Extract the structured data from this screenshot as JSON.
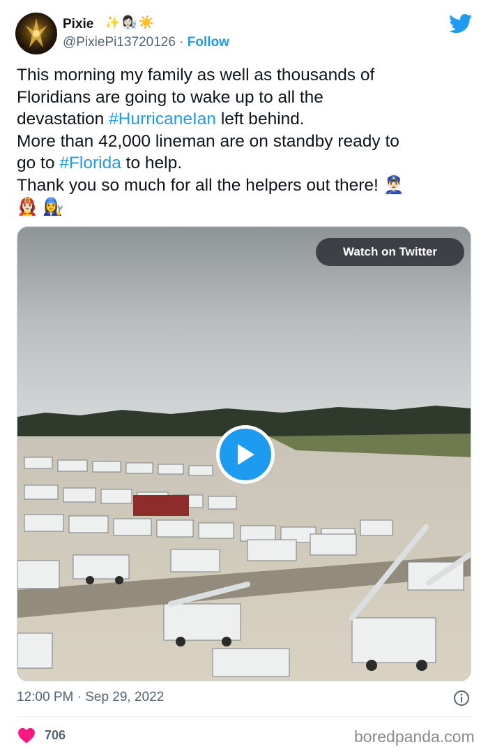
{
  "author": {
    "display_name": "Pixie",
    "name_emoji": "✨👩🏻‍🔬☀️",
    "handle": "@PixiePi13720126",
    "separator": " · ",
    "follow_label": "Follow"
  },
  "tweet": {
    "lines": [
      [
        {
          "text": "This morning my family as well as thousands of"
        }
      ],
      [
        {
          "text": "Floridians are going to wake up to all the"
        }
      ],
      [
        {
          "text": "devastation "
        },
        {
          "text": "#HurricaneIan",
          "hashtag": true
        },
        {
          "text": " left behind."
        }
      ],
      [
        {
          "text": "More than 42,000 lineman are on standby ready to"
        }
      ],
      [
        {
          "text": "go to "
        },
        {
          "text": "#Florida",
          "hashtag": true
        },
        {
          "text": " to help."
        }
      ],
      [
        {
          "text": "Thank you so much for all the helpers out there! 👮🏻‍♂️"
        }
      ],
      [
        {
          "text": "👩🏻‍🚒 👩‍🔧"
        }
      ]
    ]
  },
  "media": {
    "watch_label": "Watch on Twitter"
  },
  "footer": {
    "timestamp": "12:00 PM · Sep 29, 2022",
    "like_count": "706"
  },
  "watermark": "boredpanda.com",
  "colors": {
    "accent": "#1d9bf0",
    "like": "#f91880",
    "text_secondary": "#536471"
  },
  "icons": [
    "twitter-bird-icon",
    "play-icon",
    "info-icon",
    "heart-icon"
  ]
}
